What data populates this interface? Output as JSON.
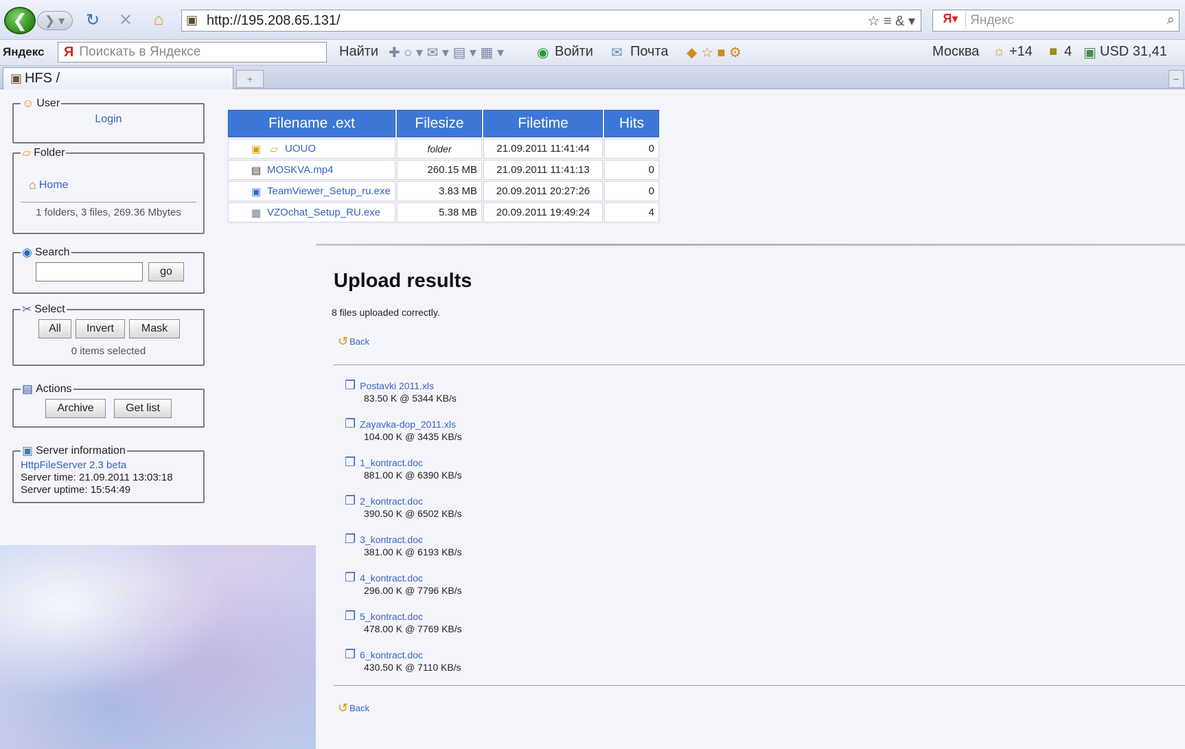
{
  "browser": {
    "url": "http://195.208.65.131/",
    "search_engine_box": "Яндекс",
    "tab_title": "HFS /",
    "icons": [
      "back-arrow-icon",
      "forward-arrow-icon",
      "refresh-icon",
      "stop-icon",
      "home-icon",
      "bookmark-star-icon",
      "search-icon"
    ]
  },
  "yandex_bar": {
    "logo": "Яндекс",
    "ya_letter": "Я",
    "search_placeholder": "Поискать в Яндексе",
    "find_label": "Найти",
    "login_label": "Войти",
    "mail_label": "Почта",
    "city": "Москва",
    "weather": "+14",
    "traffic": "4",
    "currency": "USD 31,41"
  },
  "sidebar": {
    "user": {
      "title": "User",
      "login": "Login"
    },
    "folder": {
      "title": "Folder",
      "home": "Home",
      "summary": "1 folders, 3 files, 269.36 Mbytes"
    },
    "search": {
      "title": "Search",
      "go": "go"
    },
    "select": {
      "title": "Select",
      "all": "All",
      "invert": "Invert",
      "mask": "Mask",
      "selected": "0 items selected"
    },
    "actions": {
      "title": "Actions",
      "archive": "Archive",
      "get_list": "Get list"
    },
    "server": {
      "title": "Server information",
      "version": "HttpFileServer 2.3 beta",
      "time": "Server time: 21.09.2011 13:03:18",
      "uptime": "Server uptime: 15:54:49"
    }
  },
  "files_table": {
    "headers": [
      "Filename .ext",
      "Filesize",
      "Filetime",
      "Hits"
    ],
    "rows": [
      {
        "name": "UOUO",
        "size": "folder",
        "time": "21.09.2011 11:41:44",
        "hits": "0"
      },
      {
        "name": "MOSKVA.mp4",
        "size": "260.15 MB",
        "time": "21.09.2011 11:41:13",
        "hits": "0"
      },
      {
        "name": "TeamViewer_Setup_ru.exe",
        "size": "3.83 MB",
        "time": "20.09.2011 20:27:26",
        "hits": "0"
      },
      {
        "name": "VZOchat_Setup_RU.exe",
        "size": "5.38 MB",
        "time": "20.09.2011 19:49:24",
        "hits": "4"
      }
    ]
  },
  "upload": {
    "title": "Upload results",
    "note": "8 files uploaded correctly.",
    "back": "Back",
    "items": [
      {
        "name": "Postavki 2011.xls",
        "stat": "83.50 K @ 5344 KB/s"
      },
      {
        "name": "Zayavka-dop_2011.xls",
        "stat": "104.00 K @ 3435 KB/s"
      },
      {
        "name": "1_kontract.doc",
        "stat": "881.00 K @ 6390 KB/s"
      },
      {
        "name": "2_kontract.doc",
        "stat": "390.50 K @ 6502 KB/s"
      },
      {
        "name": "3_kontract.doc",
        "stat": "381.00 K @ 6193 KB/s"
      },
      {
        "name": "4_kontract.doc",
        "stat": "296.00 K @ 7796 KB/s"
      },
      {
        "name": "5_kontract.doc",
        "stat": "478.00 K @ 7769 KB/s"
      },
      {
        "name": "6_kontract.doc",
        "stat": "430.50 K @ 7110 KB/s"
      }
    ]
  }
}
